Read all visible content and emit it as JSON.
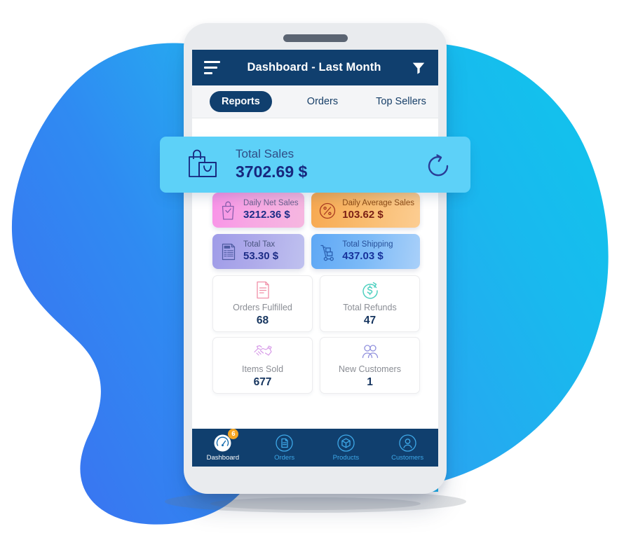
{
  "app": {
    "header": {
      "menu_icon": "hamburger-icon",
      "title": "Dashboard - Last Month",
      "filter_icon": "filter-funnel-icon",
      "bg_color": "#103f6e"
    },
    "tabs": [
      {
        "label": "Reports",
        "active": true
      },
      {
        "label": "Orders",
        "active": false
      },
      {
        "label": "Top Sellers",
        "active": false
      }
    ]
  },
  "banner": {
    "icon": "shopping-bags-icon",
    "label": "Total Sales",
    "value": "3702.69 $",
    "refresh_icon": "refresh-icon",
    "bg_color": "#5dd1f8"
  },
  "tiles": [
    {
      "icon": "bag-check-icon",
      "label": "Daily Net Sales",
      "value": "3212.36 $",
      "theme": "pink"
    },
    {
      "icon": "percent-badge-icon",
      "label": "Daily Average Sales",
      "value": "103.62 $",
      "theme": "orange"
    },
    {
      "icon": "tax-document-icon",
      "label": "Total Tax",
      "value": "53.30 $",
      "theme": "purple"
    },
    {
      "icon": "hand-truck-icon",
      "label": "Total Shipping",
      "value": "437.03 $",
      "theme": "blue"
    }
  ],
  "cards": [
    {
      "icon": "document-lines-icon",
      "label": "Orders Fulfilled",
      "value": "68",
      "color": "#f08fa8"
    },
    {
      "icon": "refund-dollar-icon",
      "label": "Total Refunds",
      "value": "47",
      "color": "#4fd0c0"
    },
    {
      "icon": "handshake-icon",
      "label": "Items Sold",
      "value": "677",
      "color": "#d79ae8"
    },
    {
      "icon": "customers-icon",
      "label": "New Customers",
      "value": "1",
      "color": "#9090dd"
    }
  ],
  "bottom_nav": [
    {
      "icon": "speedometer-icon",
      "label": "Dashboard",
      "active": true,
      "badge": "6"
    },
    {
      "icon": "orders-doc-icon",
      "label": "Orders",
      "active": false,
      "badge": null
    },
    {
      "icon": "package-icon",
      "label": "Products",
      "active": false,
      "badge": null
    },
    {
      "icon": "user-icon",
      "label": "Customers",
      "active": false,
      "badge": null
    }
  ]
}
